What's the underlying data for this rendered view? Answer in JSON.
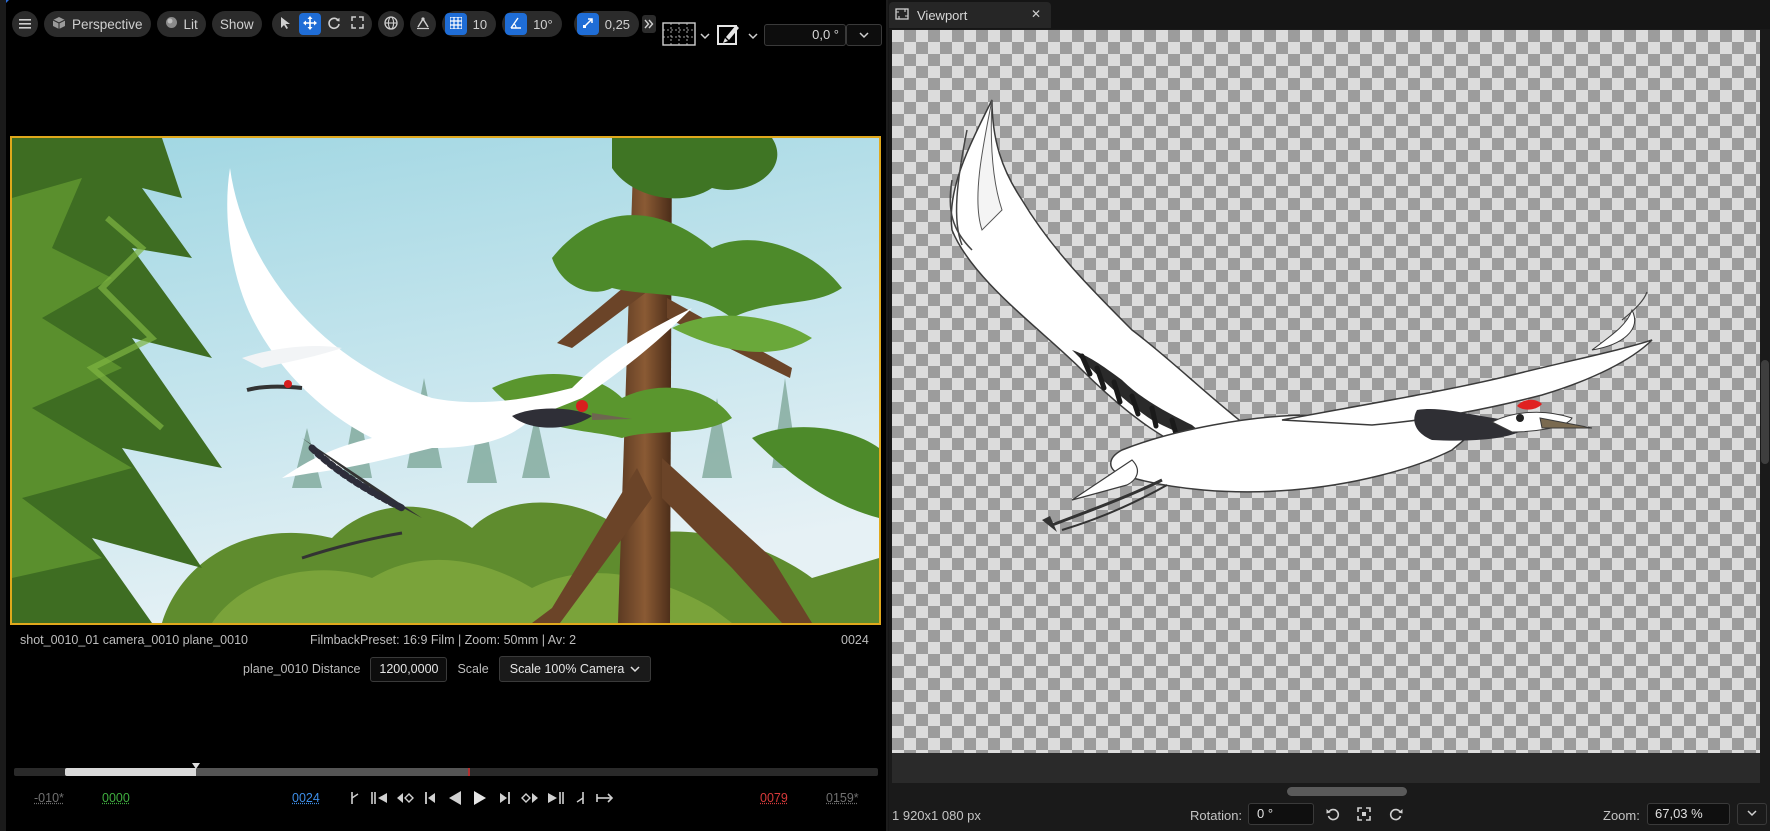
{
  "toolbar": {
    "view_mode_label": "Perspective",
    "lit_label": "Lit",
    "show_label": "Show",
    "grid_snap_value": "10",
    "angle_snap_value": "10°",
    "scale_snap_value": "0,25",
    "angle_field_value": "0,0 °"
  },
  "viewport_info": {
    "shot_label": "shot_0010_01  camera_0010  plane_0010",
    "filmback_label": "FilmbackPreset: 16:9 Film | Zoom: 50mm | Av: 2",
    "frame_counter": "0024",
    "distance_label": "plane_0010 Distance",
    "distance_value": "1200,0000",
    "scale_label": "Scale",
    "scale_option": "Scale 100% Camera"
  },
  "timeline": {
    "view_start": "-010*",
    "play_start": "0000",
    "current_frame": "0024",
    "play_end": "0079",
    "view_end": "0159*",
    "playhead_fraction": 0.211,
    "range_end_fraction": 0.526,
    "colors": {
      "play_start": "#3fae3f",
      "current": "#3d8ee8",
      "play_end": "#d83a3a",
      "muted": "#707070"
    }
  },
  "right_viewport": {
    "tab_title": "Viewport",
    "resolution": "1 920x1 080 px",
    "rotation_label": "Rotation:",
    "rotation_value": "0 °",
    "zoom_label": "Zoom:",
    "zoom_value": "67,03 %"
  },
  "icons": {
    "menu": "hamburger-icon",
    "perspective": "cube-icon",
    "lit": "sphere-icon",
    "select": "cursor-icon",
    "translate": "move-arrows-icon",
    "rotate": "rotate-icon",
    "scale": "scale-icon",
    "world": "globe-icon",
    "surface_snap": "surface-snap-icon",
    "grid": "grid-icon",
    "angle": "angle-icon",
    "scale_snap": "scale-snap-icon",
    "expand": "double-chevron-right-icon",
    "layout": "layout-grid-icon",
    "paint": "paint-tool-icon",
    "tab_viewport": "viewport-icon",
    "close": "close-icon",
    "rotate_left": "rotate-left-icon",
    "fit": "fit-view-icon",
    "rotate_right": "rotate-right-icon"
  },
  "colors": {
    "accent": "#1f6dd6",
    "frame_border": "#e0a81c"
  }
}
